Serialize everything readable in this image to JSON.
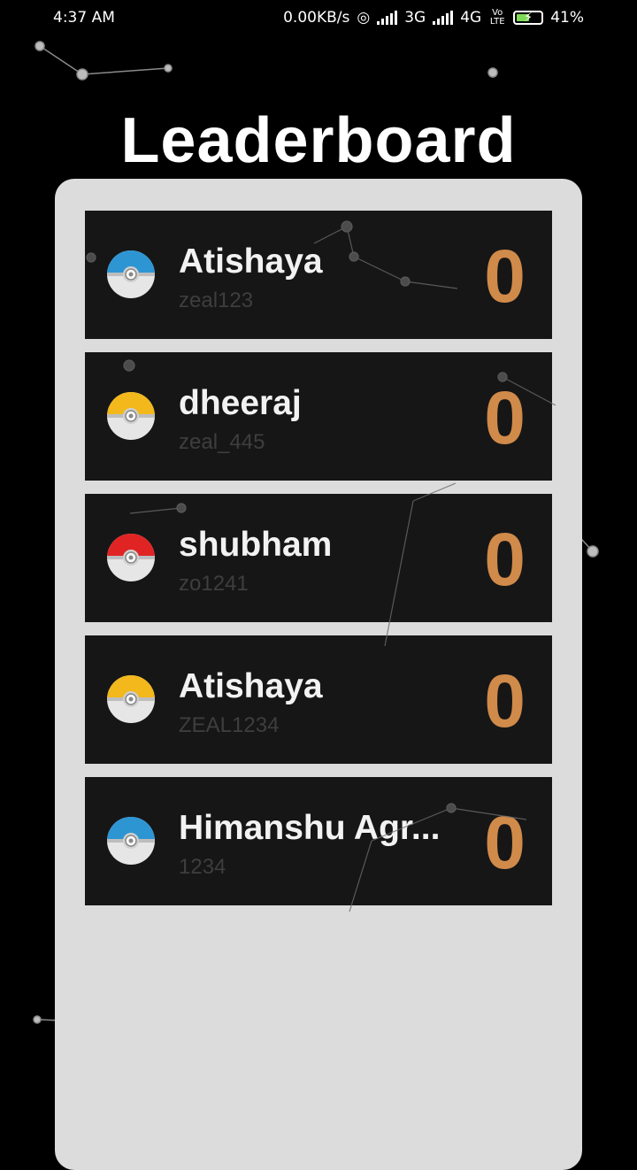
{
  "status_bar": {
    "time": "4:37 AM",
    "speed": "0.00KB/s",
    "net1": "3G",
    "net2": "4G",
    "volte": "Vo LTE",
    "battery": "41%"
  },
  "title": "Leaderboard",
  "entries": [
    {
      "name": "Atishaya",
      "username": "zeal123",
      "score": "0",
      "ball_color": "#2e95d3"
    },
    {
      "name": "dheeraj",
      "username": "zeal_445",
      "score": "0",
      "ball_color": "#f2b81c"
    },
    {
      "name": "shubham",
      "username": "zo1241",
      "score": "0",
      "ball_color": "#e02424"
    },
    {
      "name": "Atishaya",
      "username": "ZEAL1234",
      "score": "0",
      "ball_color": "#f2b81c"
    },
    {
      "name": "Himanshu Agr...",
      "username": "1234",
      "score": "0",
      "ball_color": "#2e95d3"
    }
  ],
  "colors": {
    "score": "#d08a4a",
    "row_bg": "#161616",
    "card_bg": "#dcdcdc"
  }
}
